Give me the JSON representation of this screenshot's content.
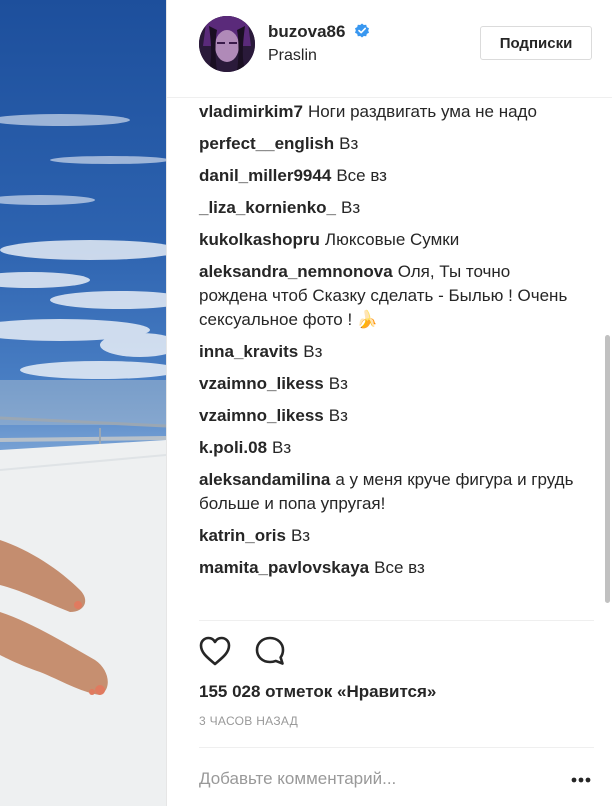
{
  "header": {
    "username": "buzova86",
    "location": "Praslin",
    "follow_label": "Подписки"
  },
  "comments": [
    {
      "user": "vladimirkim7",
      "text": "Ноги раздвигать ума не надо"
    },
    {
      "user": "perfect__english",
      "text": "Вз"
    },
    {
      "user": "danil_miller9944",
      "text": "Все вз"
    },
    {
      "user": "_liza_kornienko_",
      "text": "Вз"
    },
    {
      "user": "kukolkashopru",
      "text": "Люксовые Сумки"
    },
    {
      "user": "aleksandra_nemnonova",
      "text": "Оля, Ты точно рождена чтоб Сказку сделать - Былью ! Очень сексуальное фото ! 🍌"
    },
    {
      "user": "inna_kravits",
      "text": "Вз"
    },
    {
      "user": "vzaimno_likess",
      "text": "Вз"
    },
    {
      "user": "vzaimno_likess",
      "text": "Вз"
    },
    {
      "user": "k.poli.08",
      "text": "Вз"
    },
    {
      "user": "aleksandamilina",
      "text": "а у меня круче фигура и грудь больше и попа упругая!"
    },
    {
      "user": "katrin_oris",
      "text": "Вз"
    },
    {
      "user": "mamita_pavlovskaya",
      "text": "Все вз"
    }
  ],
  "footer": {
    "likes": "155 028 отметок «Нравится»",
    "time": "3 часов назад",
    "comment_placeholder": "Добавьте комментарий..."
  },
  "colors": {
    "verified": "#3897f0",
    "text": "#262626",
    "muted": "#999999"
  },
  "icons": [
    "heart-icon",
    "comment-icon",
    "verified-icon",
    "more-icon"
  ]
}
